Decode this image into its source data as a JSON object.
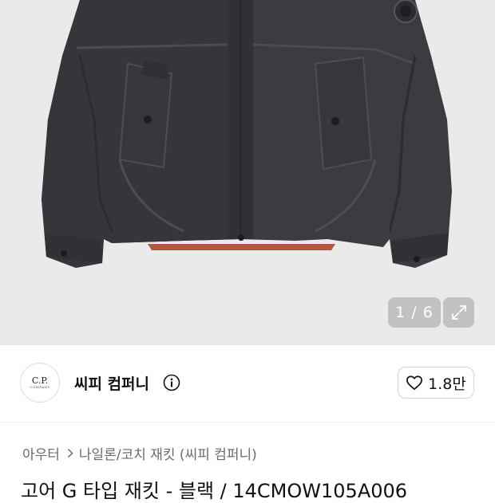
{
  "gallery": {
    "counter": "1 / 6",
    "image_alt": "고어 G 타입 재킷 - 블랙"
  },
  "brand": {
    "logo_text": "C.P.",
    "logo_subtext": "COMPANY",
    "name": "씨피 컴퍼니",
    "like_count": "1.8만"
  },
  "breadcrumb": {
    "items": [
      "아우터",
      "나일론/코치 재킷 (씨피 컴퍼니)"
    ]
  },
  "product": {
    "title": "고어 G 타입 재킷 - 블랙 / 14CMOW105A006"
  },
  "colors": {
    "hero_bg": "#eaeaea",
    "jacket": "#3a3c3f",
    "text_primary": "#111111",
    "text_secondary": "#6b6b6b"
  }
}
